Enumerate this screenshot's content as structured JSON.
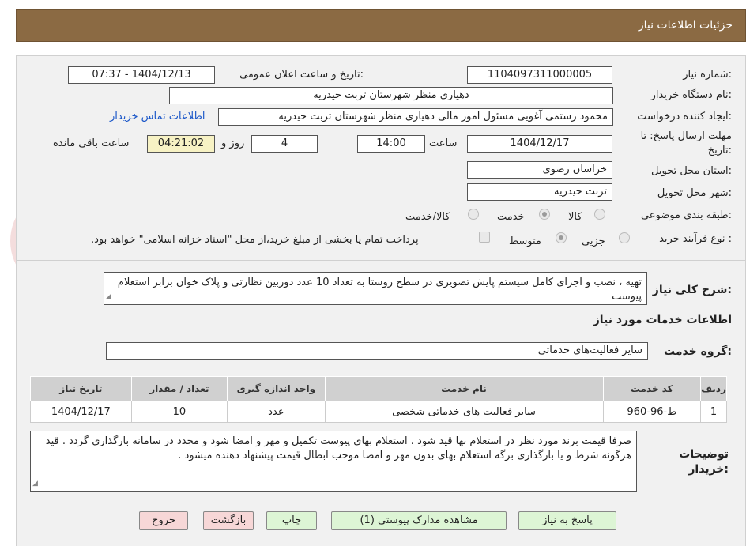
{
  "header": {
    "title": "جزئیات اطلاعات نیاز"
  },
  "fields": {
    "need_number_label": "شماره نیاز:",
    "need_number": "1104097311000005",
    "announce_label": "تاریخ و ساعت اعلان عمومی:",
    "announce_value": "1404/12/13 - 07:37",
    "buyer_org_label": "نام دستگاه خریدار:",
    "buyer_org": "دهیاری منظر  شهرستان تربت حیدریه",
    "requester_label": "ایجاد کننده درخواست:",
    "requester": "محمود رستمی آغویی مسئول امور مالی  دهیاری منظر  شهرستان تربت حیدریه",
    "contact_link": "اطلاعات تماس خریدار",
    "deadline_label_1": "مهلت ارسال پاسخ: تا",
    "deadline_label_2": "تاریخ:",
    "deadline_date": "1404/12/17",
    "time_label": "ساعت",
    "deadline_time": "14:00",
    "days_value": "4",
    "days_label": "روز و",
    "remaining_time": "04:21:02",
    "remaining_label": "ساعت باقی مانده",
    "province_label": "استان محل تحویل:",
    "province": "خراسان رضوی",
    "city_label": "شهر محل تحویل:",
    "city": "تربت حیدریه",
    "category_label": "طبقه بندی موضوعی:",
    "category_options": [
      "کالا",
      "خدمت",
      "کالا/خدمت"
    ],
    "process_label": "نوع فرآیند خرید :",
    "process_options": [
      "جزیی",
      "متوسط"
    ],
    "payment_note": "پرداخت تمام یا بخشی از مبلغ خرید،از محل \"اسناد خزانه اسلامی\" خواهد بود."
  },
  "description": {
    "label": "شرح کلی نیاز:",
    "text": "تهیه ، نصب و اجرای کامل سیستم پایش تصویری در سطح روستا به تعداد 10 عدد دوربین نظارتی و پلاک خوان برابر استعلام پیوست"
  },
  "services": {
    "section_title": "اطلاعات خدمات مورد نیاز",
    "group_label": "گروه خدمت:",
    "group_value": "سایر فعالیت‌های خدماتی",
    "columns": [
      "ردیف",
      "کد خدمت",
      "نام خدمت",
      "واحد اندازه گیری",
      "تعداد / مقدار",
      "تاریخ نیاز"
    ],
    "rows": [
      [
        "1",
        "ط-96-960",
        "سایر فعالیت های خدماتی شخصی",
        "عدد",
        "10",
        "1404/12/17"
      ]
    ]
  },
  "buyer_notes": {
    "label_1": "توضیحات",
    "label_2": "خریدار:",
    "text": "صرفا قیمت برند مورد نظر در استعلام بها قید شود . استعلام بهای پیوست تکمیل و مهر و امضا شود و مجدد در سامانه بارگذاری گردد . قید هرگونه شرط و یا بارگذاری برگه استعلام بهای بدون مهر و امضا موجب ابطال قیمت پیشنهاد دهنده میشود ."
  },
  "buttons": {
    "reply": "پاسخ به نیاز",
    "view_docs": "مشاهده مدارک پیوستی (1)",
    "print": "چاپ",
    "back": "بازگشت",
    "exit": "خروج"
  },
  "colors": {
    "header_bg": "#8b6a43",
    "link": "#1a56c8",
    "btn_green": "#ddf5d5",
    "btn_pink": "#f7d7d7",
    "remaining_bg": "#f7f2c4"
  }
}
